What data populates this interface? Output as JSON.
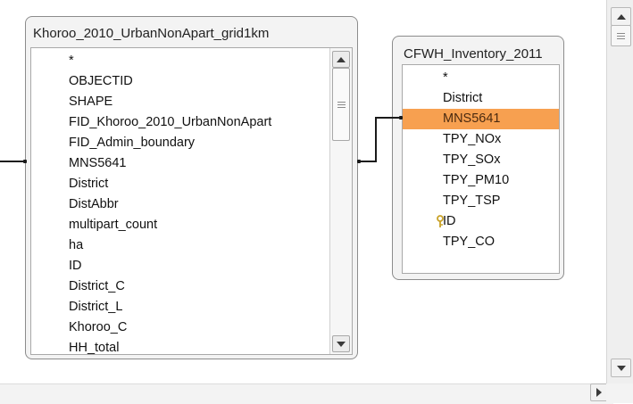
{
  "table_left": {
    "title": "Khoroo_2010_UrbanNonApart_grid1km",
    "fields": [
      "*",
      "OBJECTID",
      "SHAPE",
      "FID_Khoroo_2010_UrbanNonApart",
      "FID_Admin_boundary",
      "MNS5641",
      "District",
      "DistAbbr",
      "multipart_count",
      "ha",
      "ID",
      "District_C",
      "District_L",
      "Khoroo_C",
      "HH_total"
    ]
  },
  "table_right": {
    "title": "CFWH_Inventory_2011",
    "fields": [
      "*",
      "District",
      "MNS5641",
      "TPY_NOx",
      "TPY_SOx",
      "TPY_PM10",
      "TPY_TSP",
      "ID",
      "TPY_CO"
    ],
    "selected_field": "MNS5641",
    "primary_key_field": "ID"
  },
  "colors": {
    "selection": "#f7a050",
    "key_icon": "#c9a227"
  },
  "icons": {
    "scroll_up": "triangle-up-icon",
    "scroll_down": "triangle-down-icon",
    "scroll_right": "triangle-right-icon",
    "primary_key": "key-icon"
  }
}
